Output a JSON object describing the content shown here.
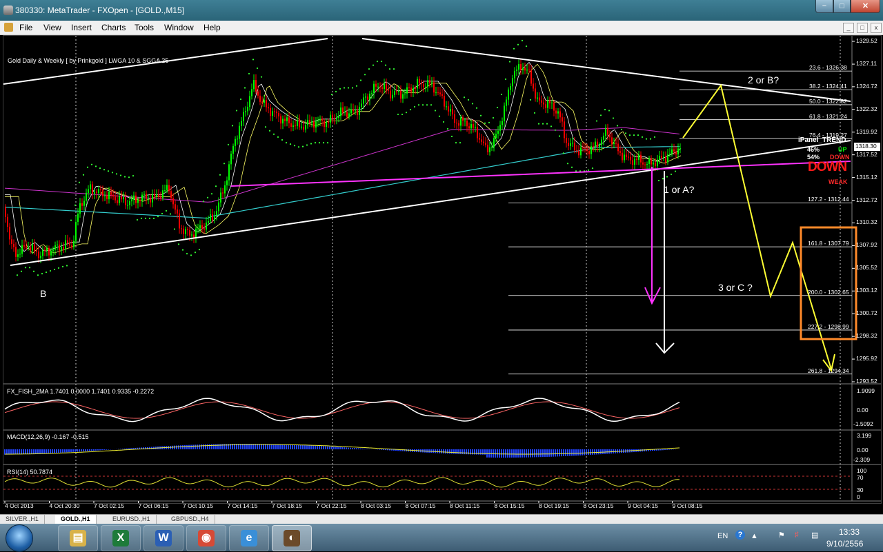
{
  "window": {
    "title": "380330: MetaTrader - FXOpen - [GOLD.,M15]",
    "min_label": "−",
    "max_label": "□",
    "close_label": "✕"
  },
  "menu": {
    "items": [
      "File",
      "View",
      "Insert",
      "Charts",
      "Tools",
      "Window",
      "Help"
    ],
    "mdi": [
      "_",
      "□",
      "x"
    ]
  },
  "chart": {
    "title": "Gold Daily & Weekly [ by Prinkgold ] LWGA 10 & SGGA 25",
    "panel": {
      "title": "iPanel_TREND",
      "pct_up": "46%",
      "up": "UP",
      "pct_down": "54%",
      "down": "DOWN",
      "big": "DOWN",
      "strength": "WEAK"
    },
    "annotations": {
      "wave_b": "B",
      "wave_2b": "2 or B?",
      "wave_1a": "1 or A?",
      "wave_3c": "3 or C ?"
    },
    "fib_levels": [
      {
        "label": "23.6 - 1326.38",
        "price": 1326.38
      },
      {
        "label": "38.2 - 1324.41",
        "price": 1324.41
      },
      {
        "label": "50.0 - 1322.82",
        "price": 1322.82
      },
      {
        "label": "61.8 - 1321.24",
        "price": 1321.24
      },
      {
        "label": "76.4 - 1319.27",
        "price": 1319.27
      },
      {
        "label": "127.2 - 1312.44",
        "price": 1312.44
      },
      {
        "label": "161.8 - 1307.79",
        "price": 1307.79
      },
      {
        "label": "200.0 - 1302.65",
        "price": 1302.65
      },
      {
        "label": "227.2 - 1298.99",
        "price": 1298.99
      },
      {
        "label": "261.8 - 1294.34",
        "price": 1294.34
      }
    ],
    "price_axis": [
      "1329.52",
      "1327.11",
      "1324.72",
      "1322.32",
      "1319.92",
      "1317.52",
      "1315.12",
      "1312.72",
      "1310.32",
      "1307.92",
      "1305.52",
      "1303.12",
      "1300.72",
      "1298.32",
      "1295.92",
      "1293.52"
    ],
    "current_price": "1318.30",
    "time_axis": [
      "4 Oct 2013",
      "4 Oct 20:30",
      "7 Oct 02:15",
      "7 Oct 06:15",
      "7 Oct 10:15",
      "7 Oct 14:15",
      "7 Oct 18:15",
      "7 Oct 22:15",
      "8 Oct 03:15",
      "8 Oct 07:15",
      "8 Oct 11:15",
      "8 Oct 15:15",
      "8 Oct 19:15",
      "8 Oct 23:15",
      "9 Oct 04:15",
      "9 Oct 08:15"
    ],
    "fisher": {
      "label": "FX_FISH_2MA 1.7401 0.0000 1.7401 0.9335 -0.2272",
      "axis": [
        "1.9099",
        "0.00",
        "-1.5092"
      ]
    },
    "macd": {
      "label": "MACD(12,26,9) -0.167 -0.515",
      "axis": [
        "3.199",
        "0.00",
        "-2.309"
      ]
    },
    "rsi": {
      "label": "RSI(14) 50.7874",
      "axis": [
        "100",
        "70",
        "30",
        "0"
      ]
    }
  },
  "tabs": [
    "SILVER.,H1",
    "GOLD.,H1",
    "EURUSD.,H1",
    "GBPUSD.,H4"
  ],
  "active_tab": "GOLD.,H1",
  "taskbar": {
    "apps": [
      {
        "name": "explorer",
        "glyph": "▤",
        "color": "#d8b24a"
      },
      {
        "name": "excel",
        "glyph": "X",
        "color": "#1e7b3a"
      },
      {
        "name": "word",
        "glyph": "W",
        "color": "#2b5fb4"
      },
      {
        "name": "chrome",
        "glyph": "◉",
        "color": "#d64a36"
      },
      {
        "name": "ie",
        "glyph": "e",
        "color": "#3a8fd8"
      },
      {
        "name": "metatrader",
        "glyph": "◐",
        "color": "#6b4a2a"
      }
    ],
    "tray": {
      "lang": "EN",
      "help": "?",
      "time": "13:33",
      "date": "9/10/2556"
    }
  },
  "colors": {
    "bull": "#00ff00",
    "bear": "#ff0000",
    "white": "#ffffff",
    "magenta": "#ff33ff",
    "yellow": "#ffff33",
    "orange": "#ff8a2a",
    "cyan": "#33cccc"
  }
}
